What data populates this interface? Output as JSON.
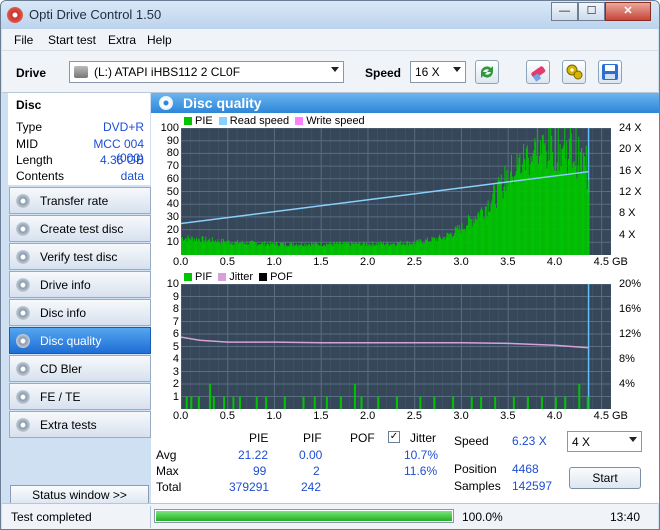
{
  "window": {
    "title": "Opti Drive Control 1.50",
    "min": "—",
    "max": "☐",
    "close": "✕"
  },
  "menu": [
    "File",
    "Start test",
    "Extra",
    "Help"
  ],
  "toolbar": {
    "drive_label": "Drive",
    "drive_value": "(L:)   ATAPI iHBS112   2 CL0F",
    "speed_label": "Speed",
    "speed_value": "16 X",
    "icons": [
      "refresh-icon",
      "eraser-icon",
      "settings-icon",
      "save-icon"
    ]
  },
  "disc": {
    "title": "Disc",
    "rows": [
      {
        "k": "Type",
        "v": "DVD+R"
      },
      {
        "k": "MID",
        "v": "MCC 004 (000)"
      },
      {
        "k": "Length",
        "v": "4.36 GB"
      },
      {
        "k": "Contents",
        "v": "data"
      }
    ]
  },
  "nav": [
    {
      "label": "Transfer rate",
      "active": false
    },
    {
      "label": "Create test disc",
      "active": false
    },
    {
      "label": "Verify test disc",
      "active": false
    },
    {
      "label": "Drive info",
      "active": false
    },
    {
      "label": "Disc info",
      "active": false
    },
    {
      "label": "Disc quality",
      "active": true
    },
    {
      "label": "CD Bler",
      "active": false
    },
    {
      "label": "FE / TE",
      "active": false
    },
    {
      "label": "Extra tests",
      "active": false
    }
  ],
  "status_window_btn": "Status window >>",
  "panel_title": "Disc quality",
  "colors": {
    "pie": "#00c400",
    "read": "#8ad0ff",
    "write": "#ff80ff",
    "pif": "#00c400",
    "jitter": "#d8a0d8",
    "pof": "#000000",
    "plot_bg": "#364759",
    "grid": "#5a6d82"
  },
  "chart_data": [
    {
      "type": "area",
      "legend": [
        "PIE",
        "Read speed",
        "Write speed"
      ],
      "y_ticks_left": [
        "100",
        "90",
        "80",
        "70",
        "60",
        "50",
        "40",
        "30",
        "20",
        "10"
      ],
      "y_ticks_right": [
        "24 X",
        "20 X",
        "16 X",
        "12 X",
        "8 X",
        "4 X"
      ],
      "x_ticks": [
        "0.0",
        "0.5",
        "1.0",
        "1.5",
        "2.0",
        "2.5",
        "3.0",
        "3.5",
        "4.0",
        "4.5 GB"
      ],
      "xlim": [
        0,
        4.6
      ],
      "ylim": [
        0,
        100
      ],
      "pie_profile": [
        [
          0,
          14
        ],
        [
          0.3,
          12
        ],
        [
          0.6,
          10
        ],
        [
          1.0,
          9
        ],
        [
          1.5,
          9
        ],
        [
          2.0,
          9
        ],
        [
          2.5,
          10
        ],
        [
          2.8,
          14
        ],
        [
          3.0,
          22
        ],
        [
          3.2,
          35
        ],
        [
          3.4,
          52
        ],
        [
          3.5,
          65
        ],
        [
          3.6,
          72
        ],
        [
          3.7,
          80
        ],
        [
          3.8,
          84
        ],
        [
          3.9,
          86
        ],
        [
          4.0,
          88
        ],
        [
          4.1,
          86
        ],
        [
          4.2,
          82
        ],
        [
          4.3,
          74
        ],
        [
          4.36,
          60
        ]
      ],
      "read_speed": [
        [
          0,
          6.2
        ],
        [
          4.36,
          16.4
        ]
      ],
      "read_speed_ylim": [
        0,
        25
      ],
      "marker_x": 4.36
    },
    {
      "type": "bar",
      "legend": [
        "PIF",
        "Jitter",
        "POF"
      ],
      "y_ticks_left": [
        "10",
        "9",
        "8",
        "7",
        "6",
        "5",
        "4",
        "3",
        "2",
        "1"
      ],
      "y_ticks_right": [
        "20%",
        "16%",
        "12%",
        "8%",
        "4%"
      ],
      "x_ticks": [
        "0.0",
        "0.5",
        "1.0",
        "1.5",
        "2.0",
        "2.5",
        "3.0",
        "3.5",
        "4.0",
        "4.5 GB"
      ],
      "xlim": [
        0,
        4.6
      ],
      "ylim": [
        0,
        10
      ],
      "jitter": [
        [
          0,
          11.5
        ],
        [
          0.2,
          11.0
        ],
        [
          0.5,
          10.7
        ],
        [
          1.0,
          10.7
        ],
        [
          1.5,
          10.6
        ],
        [
          2.0,
          10.6
        ],
        [
          2.5,
          10.6
        ],
        [
          3.0,
          10.6
        ],
        [
          3.5,
          10.5
        ],
        [
          4.0,
          10.2
        ],
        [
          4.36,
          9.8
        ]
      ],
      "jitter_ylim": [
        0,
        20
      ],
      "pif_bars": [
        [
          0.05,
          1
        ],
        [
          0.1,
          1
        ],
        [
          0.18,
          1
        ],
        [
          0.3,
          2
        ],
        [
          0.34,
          1
        ],
        [
          0.45,
          1
        ],
        [
          0.55,
          1
        ],
        [
          0.62,
          1
        ],
        [
          0.8,
          1
        ],
        [
          0.9,
          1
        ],
        [
          1.1,
          1
        ],
        [
          1.3,
          1
        ],
        [
          1.42,
          1
        ],
        [
          1.55,
          1
        ],
        [
          1.7,
          1
        ],
        [
          1.85,
          2
        ],
        [
          1.92,
          1
        ],
        [
          2.1,
          1
        ],
        [
          2.3,
          1
        ],
        [
          2.55,
          1
        ],
        [
          2.7,
          1
        ],
        [
          2.9,
          1
        ],
        [
          3.1,
          1
        ],
        [
          3.2,
          1
        ],
        [
          3.35,
          1
        ],
        [
          3.55,
          1
        ],
        [
          3.7,
          1
        ],
        [
          3.85,
          1
        ],
        [
          4.0,
          1
        ],
        [
          4.1,
          1
        ],
        [
          4.25,
          2
        ],
        [
          4.34,
          1
        ]
      ],
      "marker_x": 4.36
    }
  ],
  "stats": {
    "headers": [
      "PIE",
      "PIF",
      "POF",
      "Jitter"
    ],
    "rows": [
      {
        "label": "Avg",
        "pie": "21.22",
        "pif": "0.00",
        "pof": "",
        "jitter": "10.7%"
      },
      {
        "label": "Max",
        "pie": "99",
        "pif": "2",
        "pof": "",
        "jitter": "11.6%"
      },
      {
        "label": "Total",
        "pie": "379291",
        "pif": "242",
        "pof": "",
        "jitter": ""
      }
    ],
    "jitter_checked": "✓",
    "speed_label": "Speed",
    "speed_value": "6.23 X",
    "speed_select": "4 X",
    "position_label": "Position",
    "position_value": "4468",
    "samples_label": "Samples",
    "samples_value": "142597",
    "start_btn": "Start"
  },
  "status": {
    "text": "Test completed",
    "progress": 1.0,
    "progress_label": "100.0%",
    "time": "13:40"
  }
}
